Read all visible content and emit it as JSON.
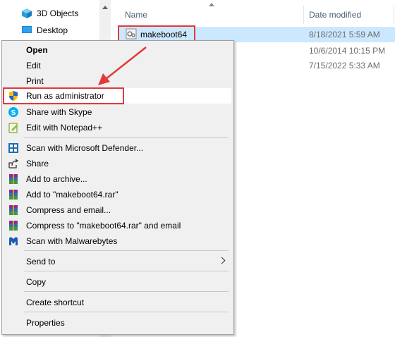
{
  "nav": {
    "items": [
      {
        "label": "3D Objects",
        "icon": "3d-objects-icon"
      },
      {
        "label": "Desktop",
        "icon": "desktop-icon"
      }
    ]
  },
  "header": {
    "name": "Name",
    "date_modified": "Date modified"
  },
  "files": [
    {
      "name": "makeboot64",
      "date": "8/18/2021 5:59 AM",
      "selected": true
    },
    {
      "name": "",
      "date": "10/6/2014 10:15 PM",
      "selected": false
    },
    {
      "name": "",
      "date": "7/15/2022 5:33 AM",
      "selected": false
    }
  ],
  "context_menu": {
    "open": "Open",
    "edit": "Edit",
    "print": "Print",
    "run_as_admin": "Run as administrator",
    "share_skype": "Share with Skype",
    "edit_notepad": "Edit with Notepad++",
    "scan_defender": "Scan with Microsoft Defender...",
    "share": "Share",
    "add_archive": "Add to archive...",
    "add_rar": "Add to \"makeboot64.rar\"",
    "compress_email": "Compress and email...",
    "compress_rar_email": "Compress to \"makeboot64.rar\" and email",
    "scan_malwarebytes": "Scan with Malwarebytes",
    "send_to": "Send to",
    "copy": "Copy",
    "create_shortcut": "Create shortcut",
    "properties": "Properties"
  },
  "colors": {
    "selection": "#cce8ff",
    "annotation_red": "#e03a3a",
    "menu_bg": "#f0f0f0"
  }
}
